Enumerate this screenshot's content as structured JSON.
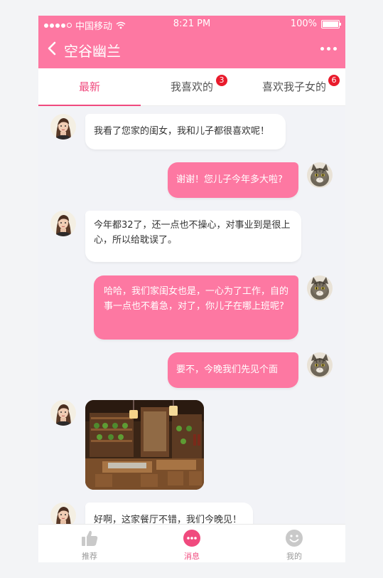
{
  "status_bar": {
    "carrier": "中国移动",
    "time": "8:21 PM",
    "battery": "100%"
  },
  "header": {
    "title": "空谷幽兰"
  },
  "tabs": [
    {
      "label": "最新"
    },
    {
      "label": "我喜欢的",
      "badge": "3"
    },
    {
      "label": "喜欢我子女的",
      "badge": "6"
    }
  ],
  "messages": [
    {
      "from": "her",
      "text": "我看了您家的闺女，我和儿子都很喜欢呢！"
    },
    {
      "from": "me",
      "text": "谢谢！您儿子今年多大啦?"
    },
    {
      "from": "her",
      "text": "今年都32了，还一点也不操心，对事业到是很上心，所以给耽误了。"
    },
    {
      "from": "me",
      "text": "哈哈，我们家闺女也是，一心为了工作，自的事一点也不着急，对了，你儿子在哪上班呢?"
    },
    {
      "from": "me",
      "text": "要不，今晚我们先见个面"
    },
    {
      "from": "her",
      "type": "image"
    },
    {
      "from": "her",
      "text": "好啊，这家餐厅不错，我们今晚见！"
    }
  ],
  "bottom_nav": [
    {
      "label": "推荐",
      "icon": "thumbs-up-icon"
    },
    {
      "label": "消息",
      "icon": "chat-bubble-icon"
    },
    {
      "label": "我的",
      "icon": "smiley-face-icon"
    }
  ],
  "colors": {
    "accent": "#fd78a2",
    "active_text": "#f04a7e",
    "badge": "#e91b2c",
    "background": "#f2f3f7"
  }
}
